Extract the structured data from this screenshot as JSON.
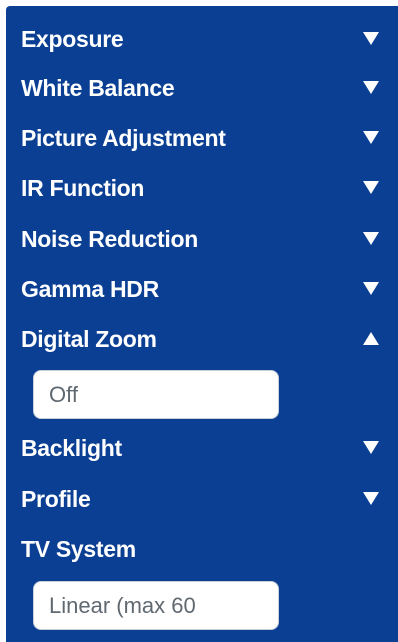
{
  "menu": {
    "items": [
      {
        "label": "Exposure",
        "state": "collapsed",
        "icon": "triangle-down-icon"
      },
      {
        "label": "White Balance",
        "state": "collapsed",
        "icon": "triangle-down-icon"
      },
      {
        "label": "Picture Adjustment",
        "state": "collapsed",
        "icon": "triangle-down-icon"
      },
      {
        "label": "IR Function",
        "state": "collapsed",
        "icon": "triangle-down-icon"
      },
      {
        "label": "Noise Reduction",
        "state": "collapsed",
        "icon": "triangle-down-icon"
      },
      {
        "label": "Gamma HDR",
        "state": "collapsed",
        "icon": "triangle-down-icon"
      },
      {
        "label": "Digital Zoom",
        "state": "expanded",
        "icon": "triangle-up-icon"
      },
      {
        "label": "Backlight",
        "state": "collapsed",
        "icon": "triangle-down-icon"
      },
      {
        "label": "Profile",
        "state": "collapsed",
        "icon": "triangle-down-icon"
      },
      {
        "label": "TV System"
      }
    ]
  },
  "digital_zoom": {
    "value": "Off"
  },
  "tv_system": {
    "value": "Linear (max 60"
  },
  "colors": {
    "panel_background": "#0b3f93",
    "text": "#ffffff",
    "field_background": "#ffffff",
    "field_text": "#606870"
  }
}
